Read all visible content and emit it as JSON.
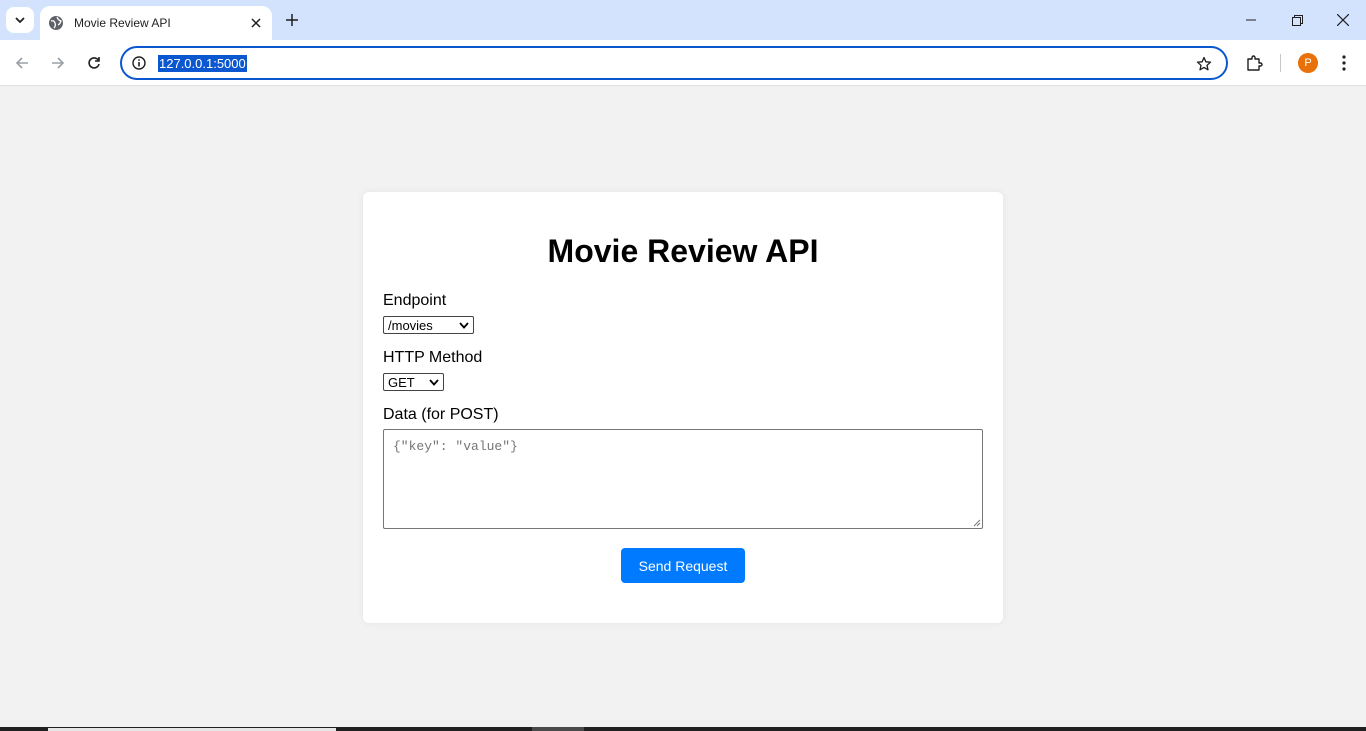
{
  "browser": {
    "tab": {
      "title": "Movie Review API"
    },
    "address_bar": {
      "url": "127.0.0.1:5000"
    },
    "profile_initial": "P"
  },
  "page": {
    "title": "Movie Review API",
    "endpoint": {
      "label": "Endpoint",
      "selected": "/movies"
    },
    "method": {
      "label": "HTTP Method",
      "selected": "GET"
    },
    "data": {
      "label": "Data (for POST)",
      "placeholder": "{\"key\": \"value\"}",
      "value": ""
    },
    "send_button": "Send Request"
  },
  "colors": {
    "tabstrip": "#d3e3fd",
    "accent": "#0b57d0",
    "button": "#007bff",
    "avatar": "#e8710a",
    "page_bg": "#f2f2f2"
  }
}
